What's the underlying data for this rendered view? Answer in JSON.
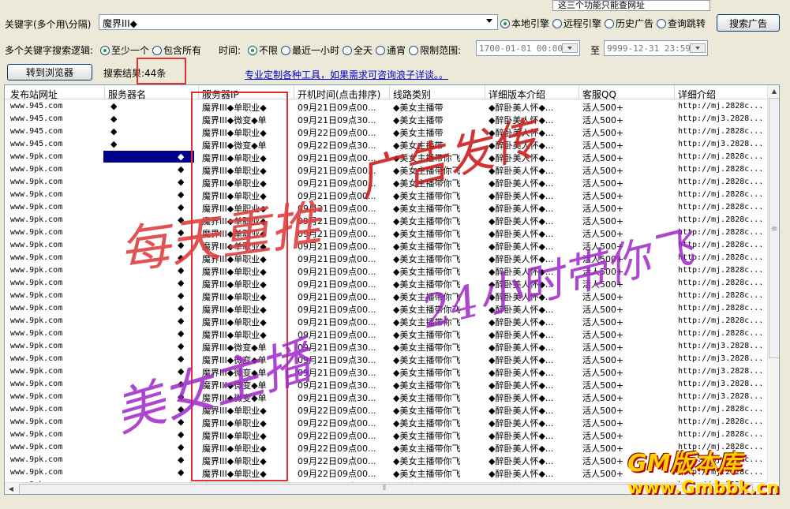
{
  "tooltip": "这三个功能只能查网址",
  "keyword": {
    "label": "关键字(多个用\\分隔)",
    "value": "魔界III◆"
  },
  "engine": {
    "options": [
      "本地引擎",
      "远程引擎",
      "历史广告",
      "查询跳转"
    ],
    "selected": 0
  },
  "search_button": "搜索广告",
  "logic": {
    "label": "多个关键字搜索逻辑:",
    "options": [
      "至少一个",
      "包含所有"
    ],
    "selected": 0
  },
  "time_filter": {
    "label": "时间:",
    "options": [
      "不限",
      "最近一小时",
      "全天",
      "通宵",
      "限制范围:"
    ],
    "selected": 0,
    "from": "1700-01-01 00:00",
    "to_label": "至",
    "to": "9999-12-31 23:59"
  },
  "browser_button": "转到浏览器",
  "result": {
    "label": "搜索结果:",
    "value": "44条"
  },
  "promo_link": "专业定制各种工具，如果需求可咨询浪子详谈。。",
  "table": {
    "headers": [
      "发布站网址",
      "服务器名",
      "服务器IP",
      "开机时间(点击排序)",
      "线路类别",
      "详细版本介绍",
      "客服QQ",
      "详细介绍"
    ],
    "rows": [
      {
        "url": "www.945.com",
        "name": "◆",
        "ip": "魔界III◆单职业◆",
        "time": "09月21日09点00...",
        "line": "◆美女主播带",
        "ver": "◆醉卧美人怀◆...",
        "qq": "活人500+",
        "intro": "http://mj.2828c..."
      },
      {
        "url": "www.945.com",
        "name": "◆",
        "ip": "魔界III◆微变◆单",
        "time": "09月21日09点30...",
        "line": "◆美女主播带",
        "ver": "◆醉卧美人怀◆...",
        "qq": "活人500+",
        "intro": "http://mj3.2828..."
      },
      {
        "url": "www.945.com",
        "name": "◆",
        "ip": "魔界III◆单职业◆",
        "time": "09月22日09点00...",
        "line": "◆美女主播带",
        "ver": "◆醉卧美人怀◆...",
        "qq": "活人500+",
        "intro": "http://mj.2828c..."
      },
      {
        "url": "www.945.com",
        "name": "◆",
        "ip": "魔界III◆微变◆单",
        "time": "09月22日09点30...",
        "line": "◆美女主播带",
        "ver": "◆醉卧美人怀◆...",
        "qq": "活人500+",
        "intro": "http://mj3.2828..."
      },
      {
        "url": "www.9pk.com",
        "name": "◆",
        "ip": "魔界III◆单职业◆",
        "time": "09月21日09点00...",
        "line": "◆美女主播带你飞",
        "ver": "◆醉卧美人怀◆...",
        "qq": "活人500+",
        "intro": "http://mj.2828c..."
      },
      {
        "url": "www.9pk.com",
        "name": "◆",
        "ip": "魔界III◆单职业◆",
        "time": "09月21日09点00...",
        "line": "◆美女主播带你飞",
        "ver": "◆醉卧美人怀◆...",
        "qq": "活人500+",
        "intro": "http://mj.2828c..."
      },
      {
        "url": "www.9pk.com",
        "name": "◆",
        "ip": "魔界III◆单职业◆",
        "time": "09月21日09点00...",
        "line": "◆美女主播带你飞",
        "ver": "◆醉卧美人怀◆...",
        "qq": "活人500+",
        "intro": "http://mj.2828c..."
      },
      {
        "url": "www.9pk.com",
        "name": "◆",
        "ip": "魔界III◆单职业◆",
        "time": "09月21日09点00...",
        "line": "◆美女主播带你飞",
        "ver": "◆醉卧美人怀◆...",
        "qq": "活人500+",
        "intro": "http://mj.2828c..."
      },
      {
        "url": "www.9pk.com",
        "name": "◆",
        "ip": "魔界III◆单职业◆",
        "time": "09月21日09点00...",
        "line": "◆美女主播带你飞",
        "ver": "◆醉卧美人怀◆...",
        "qq": "活人500+",
        "intro": "http://mj.2828c..."
      },
      {
        "url": "www.9pk.com",
        "name": "◆",
        "ip": "魔界III◆单职业◆",
        "time": "09月21日09点00...",
        "line": "◆美女主播带你飞",
        "ver": "◆醉卧美人怀◆...",
        "qq": "活人500+",
        "intro": "http://mj.2828c..."
      },
      {
        "url": "www.9pk.com",
        "name": "◆",
        "ip": "魔界III◆单职业◆",
        "time": "09月21日09点00...",
        "line": "◆美女主播带你飞",
        "ver": "◆醉卧美人怀◆...",
        "qq": "活人500+",
        "intro": "http://mj.2828c..."
      },
      {
        "url": "www.9pk.com",
        "name": "◆",
        "ip": "魔界III◆单职业◆",
        "time": "09月21日09点00...",
        "line": "◆美女主播带你飞",
        "ver": "◆醉卧美人怀◆...",
        "qq": "活人500+",
        "intro": "http://mj.2828c..."
      },
      {
        "url": "www.9pk.com",
        "name": "◆",
        "ip": "魔界III◆单职业◆",
        "time": "09月21日09点00...",
        "line": "◆美女主播带你飞",
        "ver": "◆醉卧美人怀◆...",
        "qq": "活人500+",
        "intro": "http://mj.2828c..."
      },
      {
        "url": "www.9pk.com",
        "name": "◆",
        "ip": "魔界III◆单职业◆",
        "time": "09月21日09点00...",
        "line": "◆美女主播带你飞",
        "ver": "◆醉卧美人怀◆...",
        "qq": "活人500+",
        "intro": "http://mj.2828c..."
      },
      {
        "url": "www.9pk.com",
        "name": "◆",
        "ip": "魔界III◆单职业◆",
        "time": "09月21日09点00...",
        "line": "◆美女主播带你飞",
        "ver": "◆醉卧美人怀◆...",
        "qq": "活人500+",
        "intro": "http://mj.2828c..."
      },
      {
        "url": "www.9pk.com",
        "name": "◆",
        "ip": "魔界III◆单职业◆",
        "time": "09月21日09点00...",
        "line": "◆美女主播带你飞",
        "ver": "◆醉卧美人怀◆...",
        "qq": "活人500+",
        "intro": "http://mj.2828c..."
      },
      {
        "url": "www.9pk.com",
        "name": "◆",
        "ip": "魔界III◆单职业◆",
        "time": "09月21日09点00...",
        "line": "◆美女主播带你飞",
        "ver": "◆醉卧美人怀◆...",
        "qq": "活人500+",
        "intro": "http://mj.2828c..."
      },
      {
        "url": "www.9pk.com",
        "name": "◆",
        "ip": "魔界III◆单职业◆",
        "time": "09月21日09点00...",
        "line": "◆美女主播带你飞",
        "ver": "◆醉卧美人怀◆...",
        "qq": "活人500+",
        "intro": "http://mj.2828c..."
      },
      {
        "url": "www.9pk.com",
        "name": "◆",
        "ip": "魔界III◆单职业◆",
        "time": "09月21日09点00...",
        "line": "◆美女主播带你飞",
        "ver": "◆醉卧美人怀◆...",
        "qq": "活人500+",
        "intro": "http://mj.2828c..."
      },
      {
        "url": "www.9pk.com",
        "name": "◆",
        "ip": "魔界III◆微变◆单",
        "time": "09月21日09点30...",
        "line": "◆美女主播带你飞",
        "ver": "◆醉卧美人怀◆...",
        "qq": "活人500+",
        "intro": "http://mj3.2828..."
      },
      {
        "url": "www.9pk.com",
        "name": "◆",
        "ip": "魔界III◆微变◆单",
        "time": "09月21日09点30...",
        "line": "◆美女主播带你飞",
        "ver": "◆醉卧美人怀◆...",
        "qq": "活人500+",
        "intro": "http://mj3.2828..."
      },
      {
        "url": "www.9pk.com",
        "name": "◆",
        "ip": "魔界III◆微变◆单",
        "time": "09月21日09点30...",
        "line": "◆美女主播带你飞",
        "ver": "◆醉卧美人怀◆...",
        "qq": "活人500+",
        "intro": "http://mj3.2828..."
      },
      {
        "url": "www.9pk.com",
        "name": "◆",
        "ip": "魔界III◆微变◆单",
        "time": "09月21日09点30...",
        "line": "◆美女主播带你飞",
        "ver": "◆醉卧美人怀◆...",
        "qq": "活人500+",
        "intro": "http://mj3.2828..."
      },
      {
        "url": "www.9pk.com",
        "name": "◆",
        "ip": "魔界III◆微变◆单",
        "time": "09月21日09点30...",
        "line": "◆美女主播带你飞",
        "ver": "◆醉卧美人怀◆...",
        "qq": "活人500+",
        "intro": "http://mj3.2828..."
      },
      {
        "url": "www.9pk.com",
        "name": "◆",
        "ip": "魔界III◆单职业◆",
        "time": "09月22日09点00...",
        "line": "◆美女主播带你飞",
        "ver": "◆醉卧美人怀◆...",
        "qq": "活人500+",
        "intro": "http://mj.2828c..."
      },
      {
        "url": "www.9pk.com",
        "name": "◆",
        "ip": "魔界III◆单职业◆",
        "time": "09月22日09点00...",
        "line": "◆美女主播带你飞",
        "ver": "◆醉卧美人怀◆...",
        "qq": "活人500+",
        "intro": "http://mj.2828c..."
      },
      {
        "url": "www.9pk.com",
        "name": "◆",
        "ip": "魔界III◆单职业◆",
        "time": "09月22日09点00...",
        "line": "◆美女主播带你飞",
        "ver": "◆醉卧美人怀◆...",
        "qq": "活人500+",
        "intro": "http://mj.2828c..."
      },
      {
        "url": "www.9pk.com",
        "name": "◆",
        "ip": "魔界III◆单职业◆",
        "time": "09月22日09点00...",
        "line": "◆美女主播带你飞",
        "ver": "◆醉卧美人怀◆...",
        "qq": "活人500+",
        "intro": "http://mj.2828c..."
      },
      {
        "url": "www.9pk.com",
        "name": "◆",
        "ip": "魔界III◆单职业◆",
        "time": "09月22日09点00...",
        "line": "◆美女主播带你飞",
        "ver": "◆醉卧美人怀◆...",
        "qq": "活人500+",
        "intro": "http://mj.2828c..."
      },
      {
        "url": "www.9pk.com",
        "name": "◆",
        "ip": "魔界III◆单职业◆",
        "time": "09月22日09点00...",
        "line": "◆美女主播带你飞",
        "ver": "◆醉卧美人怀◆...",
        "qq": "活人500+",
        "intro": "http://mj.2828c..."
      },
      {
        "url": "www.9pk.com",
        "name": "◆",
        "ip": "魔界III◆单职业◆",
        "time": "09月22日09点00...",
        "line": "◆美女主播带你飞",
        "ver": "◆醉卧美人怀◆...",
        "qq": "活人500+",
        "intro": "http://mj.2828c..."
      }
    ],
    "selected_row": 4
  },
  "annotations": {
    "box_label": "44条",
    "hw1": "每天重推",
    "hw2": "广告发传",
    "hw3": "美女主播",
    "hw4": "24小时带你飞"
  },
  "logo": {
    "top": "GM版本库",
    "bottom": "www.Gmbbk.cn"
  },
  "colors": {
    "selection": "#00008b",
    "annotation_red": "#e03030",
    "link": "#0000cc"
  }
}
